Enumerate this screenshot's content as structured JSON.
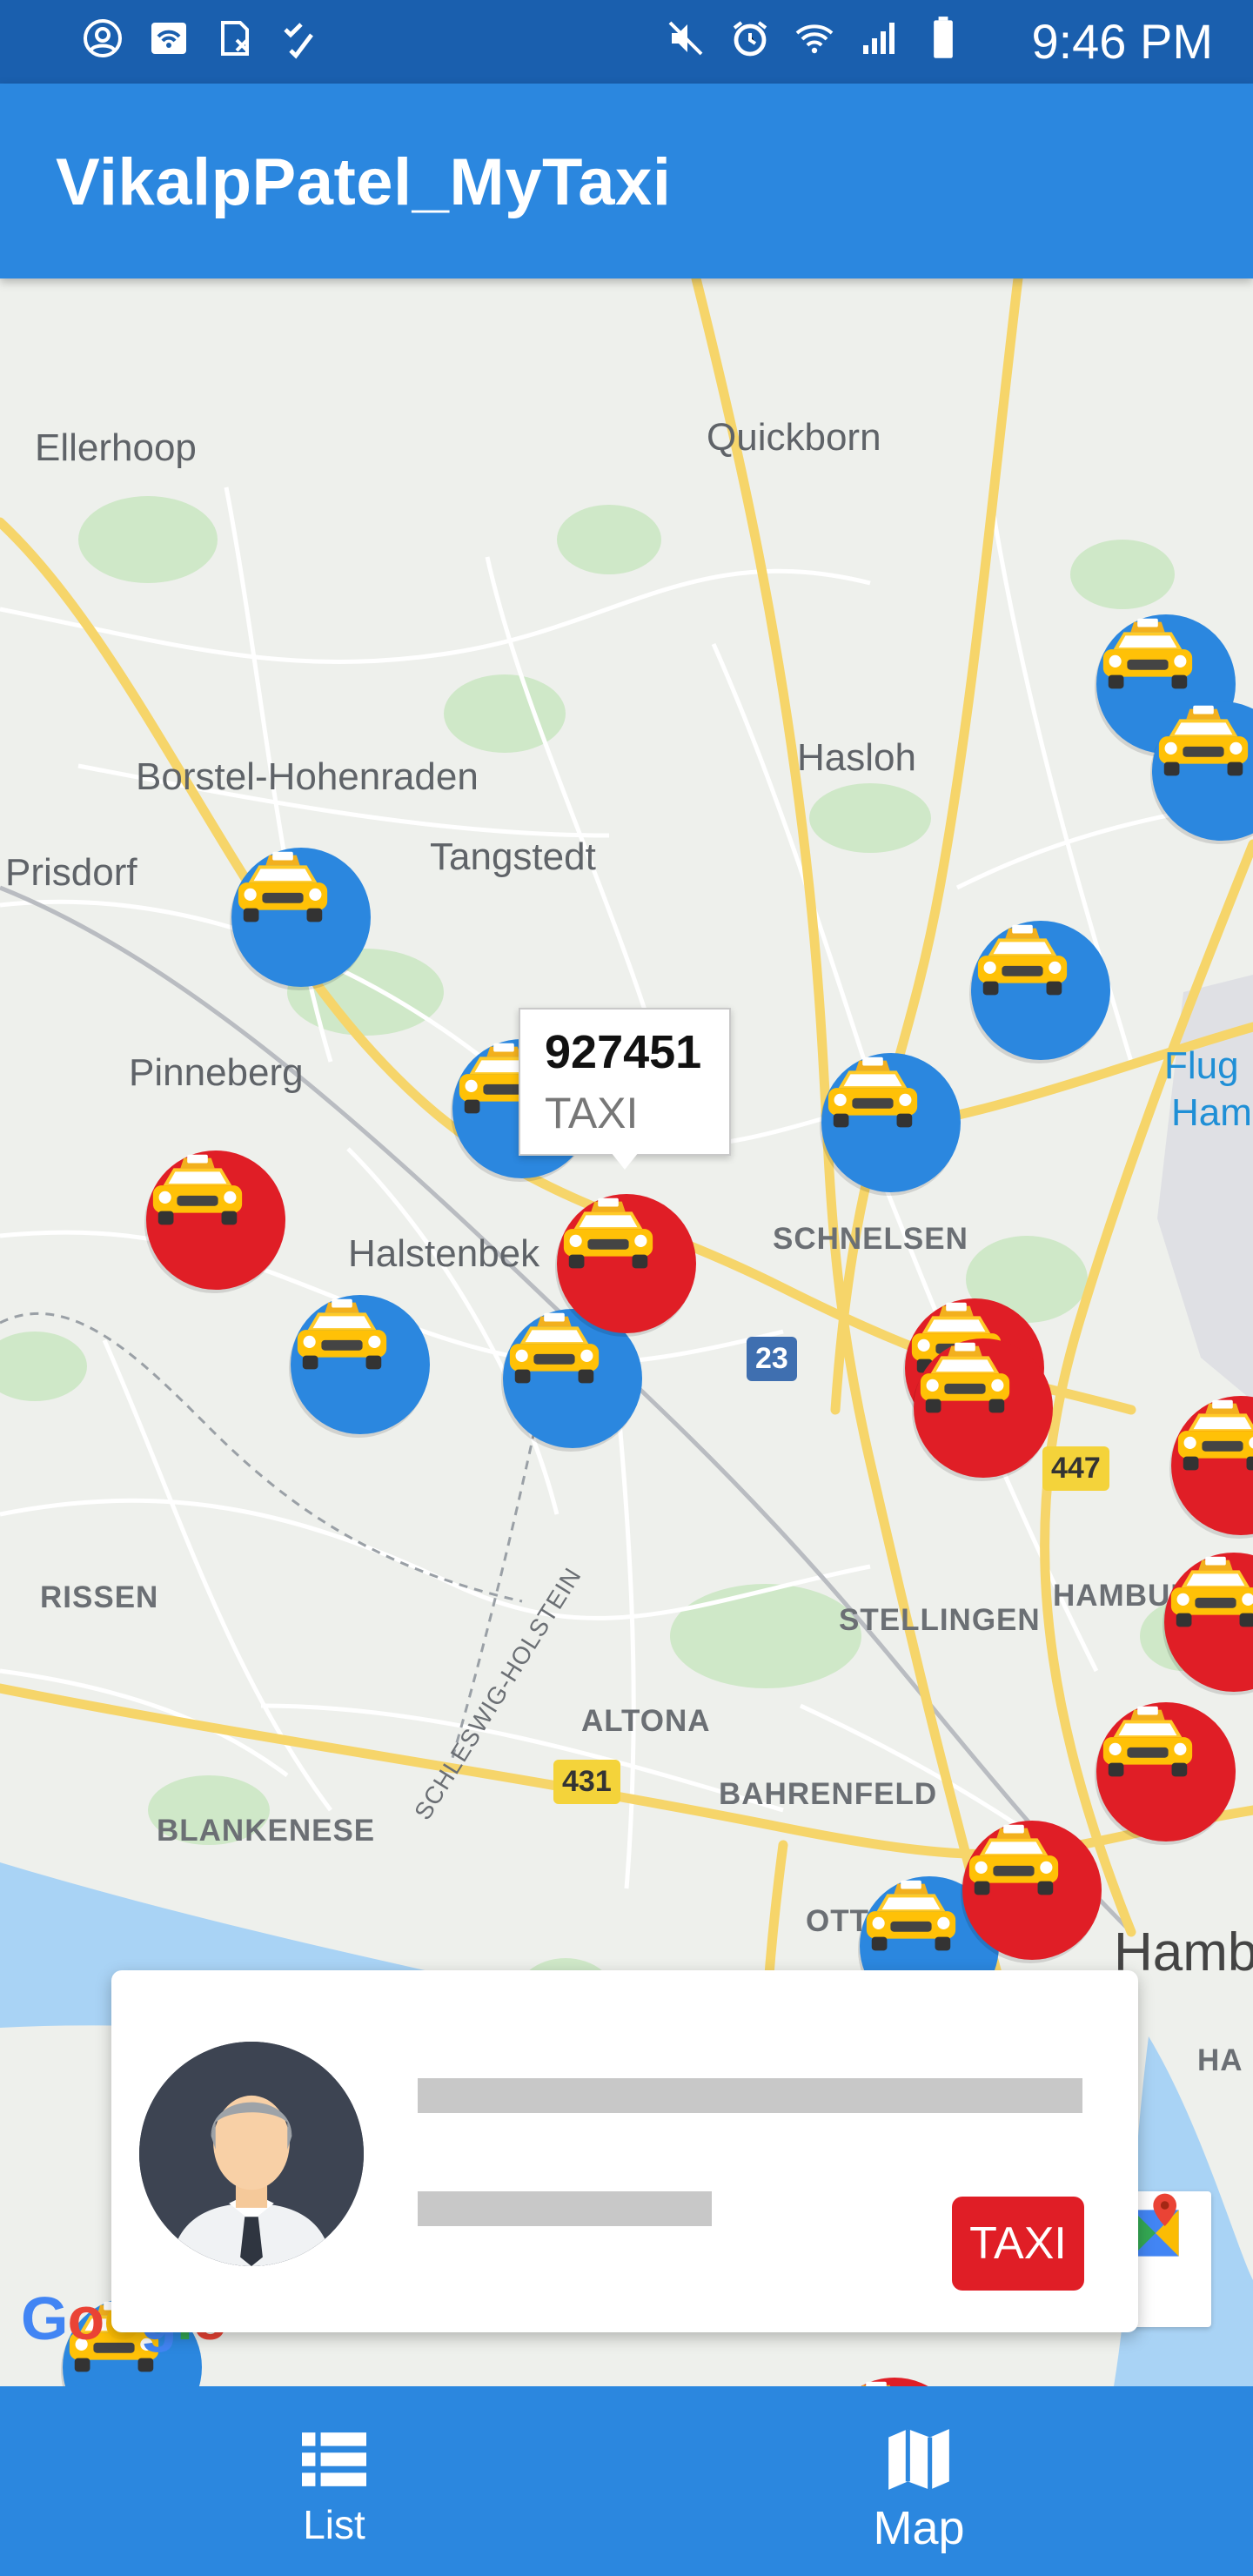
{
  "status_bar": {
    "time": "9:46 PM",
    "left_icons": [
      "account-circle-icon",
      "wifi-box-icon",
      "sim-off-icon",
      "check-list-icon"
    ],
    "right_icons": [
      "mute-icon",
      "alarm-icon",
      "wifi-icon",
      "signal-icon",
      "battery-icon"
    ]
  },
  "app_bar": {
    "title": "VikalpPatel_MyTaxi"
  },
  "map": {
    "places": [
      "Ellerhoop",
      "Quickborn",
      "Borstel-Hohenraden",
      "Hasloh",
      "Tangstedt",
      "Prisdorf",
      "Pinneberg",
      "Halstenbek",
      "SCHNELSEN",
      "RISSEN",
      "STELLINGEN",
      "HAMBURG",
      "ALTONA",
      "BAHRENFELD",
      "BLANKENESE",
      "OTT",
      "Hamb",
      "HA",
      "Flug",
      "Ham",
      "SCHLESWIG-HOLSTEIN"
    ],
    "road_numbers": [
      "23",
      "447",
      "431"
    ],
    "selected_marker": {
      "id": "927451",
      "type": "TAXI"
    },
    "markers": [
      {
        "status": "available"
      },
      {
        "status": "available"
      },
      {
        "status": "available"
      },
      {
        "status": "available"
      },
      {
        "status": "available"
      },
      {
        "status": "available"
      },
      {
        "status": "available"
      },
      {
        "status": "available"
      },
      {
        "status": "available"
      },
      {
        "status": "available"
      },
      {
        "status": "selected"
      },
      {
        "status": "busy"
      },
      {
        "status": "busy"
      },
      {
        "status": "busy"
      },
      {
        "status": "busy"
      },
      {
        "status": "busy"
      },
      {
        "status": "busy"
      },
      {
        "status": "busy"
      }
    ],
    "attribution": "Google",
    "colors": {
      "available": "#2b87df",
      "busy": "#e01e26"
    }
  },
  "driver_card": {
    "badge": "TAXI",
    "avatar": "driver-avatar"
  },
  "bottom_nav": {
    "items": [
      {
        "label": "List",
        "icon": "list-icon"
      },
      {
        "label": "Map",
        "icon": "map-icon"
      }
    ],
    "active": "Map"
  },
  "colors": {
    "primary": "#2b87df",
    "status_bar": "#1a5fae",
    "accent": "#e01e26"
  }
}
